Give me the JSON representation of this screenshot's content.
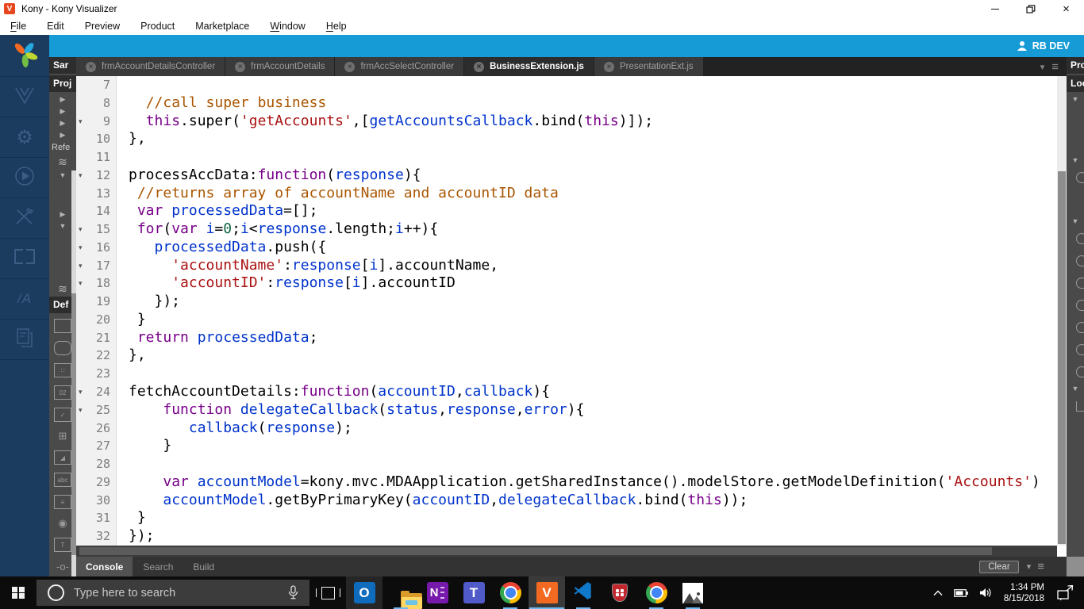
{
  "colors": {
    "accent_blue": "#169bd7",
    "taskbar_underline": "#6cb8f0",
    "syntax": {
      "keyword": "#770088",
      "variable": "#0033cc",
      "string": "#aa1111",
      "comment": "#aa5500",
      "number": "#116644"
    }
  },
  "window": {
    "title": "Kony - Kony Visualizer",
    "icon_letter": "V"
  },
  "menu": {
    "items": [
      {
        "label": "File",
        "key": 0
      },
      {
        "label": "Edit",
        "key": -1
      },
      {
        "label": "Preview",
        "key": -1
      },
      {
        "label": "Product",
        "key": -1
      },
      {
        "label": "Marketplace",
        "key": -1
      },
      {
        "label": "Window",
        "key": 0
      },
      {
        "label": "Help",
        "key": 0
      }
    ]
  },
  "header": {
    "user_label": "RB DEV"
  },
  "activity_bar": {
    "icons": [
      "kony-logo",
      "visualizer-v",
      "settings-gear",
      "run-play",
      "build-tools",
      "canvas-brackets",
      "skins-slash-a",
      "notes-document"
    ]
  },
  "left_strip": {
    "items": [
      {
        "type": "header",
        "label": "Sar"
      },
      {
        "type": "header",
        "label": "Proj"
      },
      {
        "type": "arrow-right"
      },
      {
        "type": "arrow-right"
      },
      {
        "type": "arrow-right"
      },
      {
        "type": "arrow-right"
      },
      {
        "type": "label",
        "label": "Refe"
      },
      {
        "type": "icon",
        "name": "layers"
      },
      {
        "type": "arrow-down"
      },
      {
        "type": "gap-sm"
      },
      {
        "type": "arrow-right"
      },
      {
        "type": "arrow-down"
      },
      {
        "type": "gap-lg"
      },
      {
        "type": "icon",
        "name": "layers"
      },
      {
        "type": "header",
        "label": "Def"
      },
      {
        "type": "widget",
        "name": "button"
      },
      {
        "type": "widget",
        "name": "flex-container"
      },
      {
        "type": "widget",
        "name": "calendar"
      },
      {
        "type": "widget",
        "name": "date-picker"
      },
      {
        "type": "widget",
        "name": "checkbox"
      },
      {
        "type": "widget",
        "name": "data-grid"
      },
      {
        "type": "widget",
        "name": "image"
      },
      {
        "type": "widget",
        "name": "text-box"
      },
      {
        "type": "widget",
        "name": "segment-list"
      },
      {
        "type": "widget",
        "name": "radio-button"
      },
      {
        "type": "widget",
        "name": "label-text"
      },
      {
        "type": "widget",
        "name": "slider"
      }
    ]
  },
  "right_strip": {
    "items": [
      {
        "type": "header",
        "label": "Prop"
      },
      {
        "type": "header",
        "label": "Loo"
      },
      {
        "type": "arrow-down"
      },
      {
        "type": "gap-lg"
      },
      {
        "type": "arrow-down"
      },
      {
        "type": "icon",
        "name": "skin"
      },
      {
        "type": "gap-sm"
      },
      {
        "type": "arrow-down"
      },
      {
        "type": "icon",
        "name": "skin"
      },
      {
        "type": "icon",
        "name": "skin"
      },
      {
        "type": "icon",
        "name": "skin"
      },
      {
        "type": "icon",
        "name": "skin"
      },
      {
        "type": "icon",
        "name": "skin"
      },
      {
        "type": "icon",
        "name": "skin"
      },
      {
        "type": "icon",
        "name": "skin"
      },
      {
        "type": "arrow-down"
      },
      {
        "type": "icon",
        "name": "corner"
      }
    ]
  },
  "tabs": {
    "items": [
      {
        "label": "frmAccountDetailsController",
        "active": false
      },
      {
        "label": "frmAccountDetails",
        "active": false
      },
      {
        "label": "frmAccSelectController",
        "active": false
      },
      {
        "label": "BusinessExtension.js",
        "active": true
      },
      {
        "label": "PresentationExt.js",
        "active": false
      }
    ]
  },
  "editor": {
    "lines": [
      {
        "n": 7,
        "fold": false,
        "segs": []
      },
      {
        "n": 8,
        "fold": false,
        "segs": [
          [
            "p",
            "  "
          ],
          [
            "c",
            "//call super business"
          ]
        ]
      },
      {
        "n": 9,
        "fold": true,
        "segs": [
          [
            "p",
            "  "
          ],
          [
            "k",
            "this"
          ],
          [
            "p",
            ".super("
          ],
          [
            "s",
            "'getAccounts'"
          ],
          [
            "p",
            ",["
          ],
          [
            "v",
            "getAccountsCallback"
          ],
          [
            "p",
            ".bind("
          ],
          [
            "k",
            "this"
          ],
          [
            "p",
            ")]);"
          ]
        ]
      },
      {
        "n": 10,
        "fold": false,
        "segs": [
          [
            "p",
            "},"
          ]
        ]
      },
      {
        "n": 11,
        "fold": false,
        "segs": []
      },
      {
        "n": 12,
        "fold": true,
        "segs": [
          [
            "p",
            "processAccData:"
          ],
          [
            "k",
            "function"
          ],
          [
            "p",
            "("
          ],
          [
            "v",
            "response"
          ],
          [
            "p",
            "){"
          ]
        ]
      },
      {
        "n": 13,
        "fold": false,
        "segs": [
          [
            "p",
            " "
          ],
          [
            "c",
            "//returns array of accountName and accountID data"
          ]
        ]
      },
      {
        "n": 14,
        "fold": false,
        "segs": [
          [
            "p",
            " "
          ],
          [
            "k",
            "var"
          ],
          [
            "p",
            " "
          ],
          [
            "v",
            "processedData"
          ],
          [
            "p",
            "=[];"
          ]
        ]
      },
      {
        "n": 15,
        "fold": true,
        "segs": [
          [
            "p",
            " "
          ],
          [
            "k",
            "for"
          ],
          [
            "p",
            "("
          ],
          [
            "k",
            "var"
          ],
          [
            "p",
            " "
          ],
          [
            "v",
            "i"
          ],
          [
            "p",
            "="
          ],
          [
            "n",
            "0"
          ],
          [
            "p",
            ";"
          ],
          [
            "v",
            "i"
          ],
          [
            "p",
            "<"
          ],
          [
            "v",
            "response"
          ],
          [
            "p",
            ".length;"
          ],
          [
            "v",
            "i"
          ],
          [
            "p",
            "++){"
          ]
        ]
      },
      {
        "n": 16,
        "fold": true,
        "segs": [
          [
            "p",
            "   "
          ],
          [
            "v",
            "processedData"
          ],
          [
            "p",
            ".push({"
          ]
        ]
      },
      {
        "n": 17,
        "fold": true,
        "segs": [
          [
            "p",
            "     "
          ],
          [
            "s",
            "'accountName'"
          ],
          [
            "p",
            ":"
          ],
          [
            "v",
            "response"
          ],
          [
            "p",
            "["
          ],
          [
            "v",
            "i"
          ],
          [
            "p",
            "].accountName,"
          ]
        ]
      },
      {
        "n": 18,
        "fold": true,
        "segs": [
          [
            "p",
            "     "
          ],
          [
            "s",
            "'accountID'"
          ],
          [
            "p",
            ":"
          ],
          [
            "v",
            "response"
          ],
          [
            "p",
            "["
          ],
          [
            "v",
            "i"
          ],
          [
            "p",
            "].accountID"
          ]
        ]
      },
      {
        "n": 19,
        "fold": false,
        "segs": [
          [
            "p",
            "   });"
          ]
        ]
      },
      {
        "n": 20,
        "fold": false,
        "segs": [
          [
            "p",
            " }"
          ]
        ]
      },
      {
        "n": 21,
        "fold": false,
        "segs": [
          [
            "p",
            " "
          ],
          [
            "k",
            "return"
          ],
          [
            "p",
            " "
          ],
          [
            "v",
            "processedData"
          ],
          [
            "p",
            ";"
          ]
        ]
      },
      {
        "n": 22,
        "fold": false,
        "segs": [
          [
            "p",
            "},"
          ]
        ]
      },
      {
        "n": 23,
        "fold": false,
        "segs": []
      },
      {
        "n": 24,
        "fold": true,
        "segs": [
          [
            "p",
            "fetchAccountDetails:"
          ],
          [
            "k",
            "function"
          ],
          [
            "p",
            "("
          ],
          [
            "v",
            "accountID"
          ],
          [
            "p",
            ","
          ],
          [
            "v",
            "callback"
          ],
          [
            "p",
            "){"
          ]
        ]
      },
      {
        "n": 25,
        "fold": true,
        "segs": [
          [
            "p",
            "    "
          ],
          [
            "k",
            "function"
          ],
          [
            "p",
            " "
          ],
          [
            "v",
            "delegateCallback"
          ],
          [
            "p",
            "("
          ],
          [
            "v",
            "status"
          ],
          [
            "p",
            ","
          ],
          [
            "v",
            "response"
          ],
          [
            "p",
            ","
          ],
          [
            "v",
            "error"
          ],
          [
            "p",
            "){"
          ]
        ]
      },
      {
        "n": 26,
        "fold": false,
        "segs": [
          [
            "p",
            "       "
          ],
          [
            "v",
            "callback"
          ],
          [
            "p",
            "("
          ],
          [
            "v",
            "response"
          ],
          [
            "p",
            ");"
          ]
        ]
      },
      {
        "n": 27,
        "fold": false,
        "segs": [
          [
            "p",
            "    }"
          ]
        ]
      },
      {
        "n": 28,
        "fold": false,
        "segs": []
      },
      {
        "n": 29,
        "fold": false,
        "segs": [
          [
            "p",
            "    "
          ],
          [
            "k",
            "var"
          ],
          [
            "p",
            " "
          ],
          [
            "v",
            "accountModel"
          ],
          [
            "p",
            "=kony.mvc.MDAApplication.getSharedInstance().modelStore.getModelDefinition("
          ],
          [
            "s",
            "'Accounts'"
          ],
          [
            "p",
            ")"
          ]
        ]
      },
      {
        "n": 30,
        "fold": false,
        "segs": [
          [
            "p",
            "    "
          ],
          [
            "v",
            "accountModel"
          ],
          [
            "p",
            ".getByPrimaryKey("
          ],
          [
            "v",
            "accountID"
          ],
          [
            "p",
            ","
          ],
          [
            "v",
            "delegateCallback"
          ],
          [
            "p",
            ".bind("
          ],
          [
            "k",
            "this"
          ],
          [
            "p",
            "));"
          ]
        ]
      },
      {
        "n": 31,
        "fold": false,
        "segs": [
          [
            "p",
            " }"
          ]
        ]
      },
      {
        "n": 32,
        "fold": false,
        "segs": [
          [
            "p",
            "});"
          ]
        ]
      }
    ]
  },
  "console": {
    "tabs": [
      {
        "label": "Console",
        "active": true
      },
      {
        "label": "Search",
        "active": false
      },
      {
        "label": "Build",
        "active": false
      }
    ],
    "clear_label": "Clear"
  },
  "taskbar": {
    "search": {
      "placeholder": "Type here to search"
    },
    "apps": [
      {
        "name": "outlook",
        "open": false,
        "highlighted": true
      },
      {
        "name": "file-explorer",
        "open": true,
        "highlighted": false
      },
      {
        "name": "onenote",
        "open": false,
        "highlighted": false
      },
      {
        "name": "teams",
        "open": false,
        "highlighted": false
      },
      {
        "name": "chrome",
        "open": true,
        "highlighted": false
      },
      {
        "name": "kony-visualizer",
        "open": true,
        "highlighted": false,
        "focused": true
      },
      {
        "name": "vscode",
        "open": true,
        "highlighted": false
      },
      {
        "name": "security-shield",
        "open": false,
        "highlighted": false
      },
      {
        "name": "chrome-2",
        "open": true,
        "highlighted": false
      },
      {
        "name": "photos",
        "open": true,
        "highlighted": false
      }
    ],
    "tray": {
      "time": "1:34 PM",
      "date": "8/15/2018"
    }
  }
}
